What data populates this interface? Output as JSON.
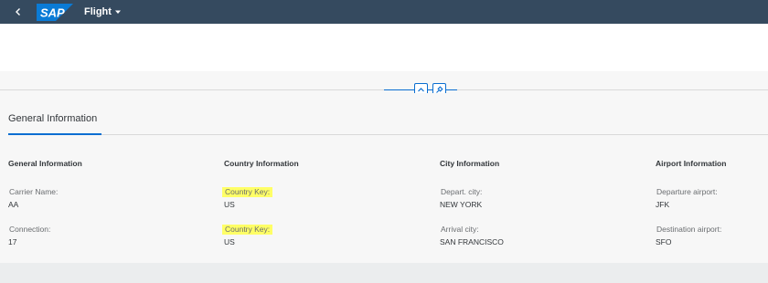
{
  "shell": {
    "app_title": "Flight",
    "logo_text": "SAP",
    "colors": {
      "shell_bg": "#354a5f",
      "accent": "#0a6ed1",
      "highlight": "#ffff66"
    },
    "icons": [
      "back-icon",
      "sap-logo",
      "chevron-down-icon",
      "collapse-header-icon",
      "pin-icon"
    ]
  },
  "section": {
    "tab_label": "General Information"
  },
  "groups": [
    {
      "title": "General Information",
      "fields": [
        {
          "label": "Carrier Name:",
          "value": "AA"
        },
        {
          "label": "Connection:",
          "value": "17"
        }
      ]
    },
    {
      "title": "Country Information",
      "fields": [
        {
          "label": "Country Key:",
          "value": "US",
          "highlighted": true
        },
        {
          "label": "Country Key:",
          "value": "US",
          "highlighted": true
        }
      ]
    },
    {
      "title": "City Information",
      "fields": [
        {
          "label": "Depart. city:",
          "value": "NEW YORK"
        },
        {
          "label": "Arrival city:",
          "value": "SAN FRANCISCO"
        }
      ]
    },
    {
      "title": "Airport Information",
      "fields": [
        {
          "label": "Departure airport:",
          "value": "JFK"
        },
        {
          "label": "Destination airport:",
          "value": "SFO"
        }
      ]
    }
  ]
}
